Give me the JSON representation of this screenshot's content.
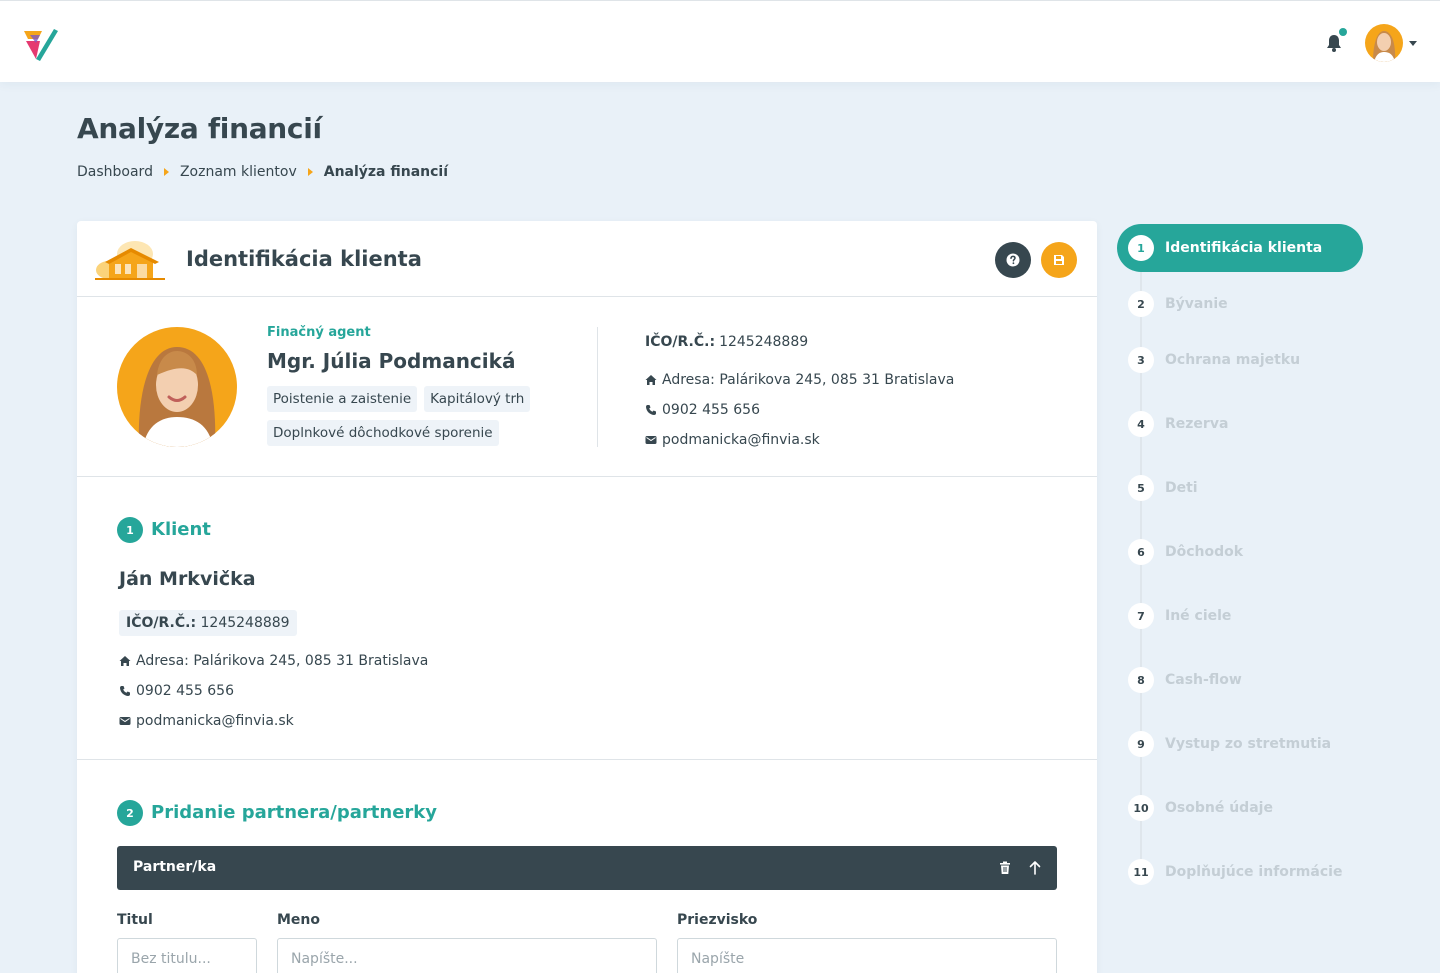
{
  "page": {
    "title": "Analýza financií",
    "breadcrumb": [
      "Dashboard",
      "Zoznam klientov",
      "Analýza financií"
    ]
  },
  "header": {
    "notification_dot_color": "#26a69a"
  },
  "card": {
    "title": "Identifikácia klienta"
  },
  "agent": {
    "role": "Finačný agent",
    "name": "Mgr. Júlia Podmanciká",
    "tags": [
      "Poistenie a zaistenie",
      "Kapitálový trh",
      "Doplnkové dôchodkové sporenie"
    ],
    "id_label": "IČO/R.Č.:",
    "id_value": "1245248889",
    "address": "Adresa: Palárikova 245, 085 31 Bratislava",
    "phone": "0902 455 656",
    "email": "podmanicka@finvia.sk"
  },
  "client_section": {
    "number": "1",
    "title": "Klient",
    "name": "Ján Mrkvička",
    "id_label": "IČO/R.Č.:",
    "id_value": "1245248889",
    "address": "Adresa: Palárikova 245, 085 31 Bratislava",
    "phone": "0902 455 656",
    "email": "podmanicka@finvia.sk"
  },
  "partner_section": {
    "number": "2",
    "title": "Pridanie partnera/partnerky",
    "bar_label": "Partner/ka",
    "fields": {
      "title_label": "Titul",
      "title_placeholder": "Bez titulu...",
      "name_label": "Meno",
      "name_placeholder": "Napíšte...",
      "surname_label": "Priezvisko",
      "surname_placeholder": "Napíšte"
    }
  },
  "steps": [
    {
      "num": "1",
      "label": "Identifikácia klienta"
    },
    {
      "num": "2",
      "label": "Bývanie"
    },
    {
      "num": "3",
      "label": "Ochrana majetku"
    },
    {
      "num": "4",
      "label": "Rezerva"
    },
    {
      "num": "5",
      "label": "Deti"
    },
    {
      "num": "6",
      "label": "Dôchodok"
    },
    {
      "num": "7",
      "label": "Iné ciele"
    },
    {
      "num": "8",
      "label": "Cash-flow"
    },
    {
      "num": "9",
      "label": "Vystup zo stretmutia"
    },
    {
      "num": "10",
      "label": "Osobné údaje"
    },
    {
      "num": "11",
      "label": "Doplňujúce informácie"
    }
  ],
  "colors": {
    "accent": "#26a69a",
    "warning": "#f5a51a",
    "dark": "#37474f"
  }
}
